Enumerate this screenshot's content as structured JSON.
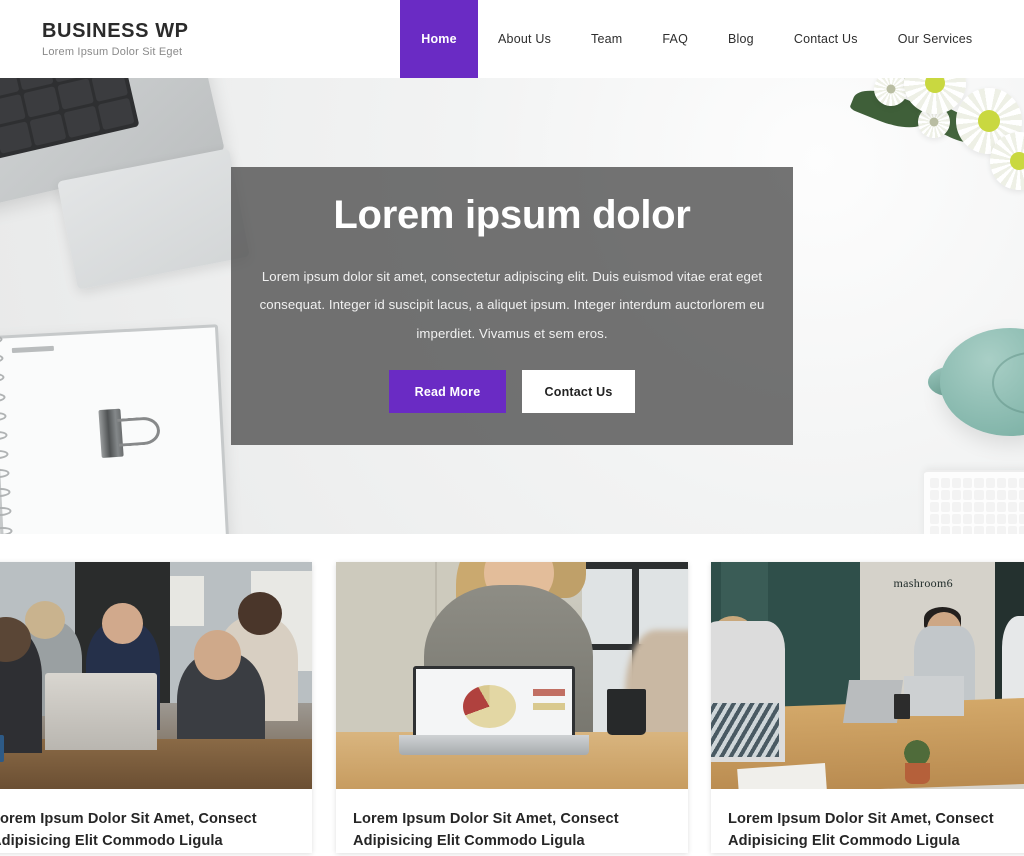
{
  "header": {
    "brand_title": "BUSINESS WP",
    "brand_tagline": "Lorem Ipsum Dolor Sit Eget",
    "nav": [
      {
        "label": "Home",
        "active": true
      },
      {
        "label": "About Us",
        "active": false
      },
      {
        "label": "Team",
        "active": false
      },
      {
        "label": "FAQ",
        "active": false
      },
      {
        "label": "Blog",
        "active": false
      },
      {
        "label": "Contact Us",
        "active": false
      },
      {
        "label": "Our Services",
        "active": false
      }
    ]
  },
  "hero": {
    "title": "Lorem ipsum dolor",
    "text": "Lorem ipsum dolor sit amet, consectetur adipiscing elit. Duis euismod vitae erat eget consequat. Integer id suscipit lacus, a aliquet ipsum. Integer interdum auctorlorem eu imperdiet. Vivamus et sem eros.",
    "primary_button": "Read More",
    "secondary_button": "Contact Us"
  },
  "cards": [
    {
      "title": "Lorem Ipsum Dolor Sit Amet, Consect Adipisicing Elit Commodo Ligula",
      "image_alt": "business-team-meeting-laptop"
    },
    {
      "title": "Lorem Ipsum Dolor Sit Amet, Consect Adipisicing Elit Commodo Ligula",
      "image_alt": "woman-presenting-laptop-pie-chart"
    },
    {
      "title": "Lorem Ipsum Dolor Sit Amet, Consect Adipisicing Elit Commodo Ligula",
      "image_alt": "conference-room-meeting"
    }
  ],
  "card3_sign_text": "mashroom6",
  "colors": {
    "accent_purple": "#6A2BC4",
    "hero_overlay": "rgba(80,80,80,0.80)",
    "text_dark": "#262626",
    "tagline_gray": "#8a8a8a"
  }
}
